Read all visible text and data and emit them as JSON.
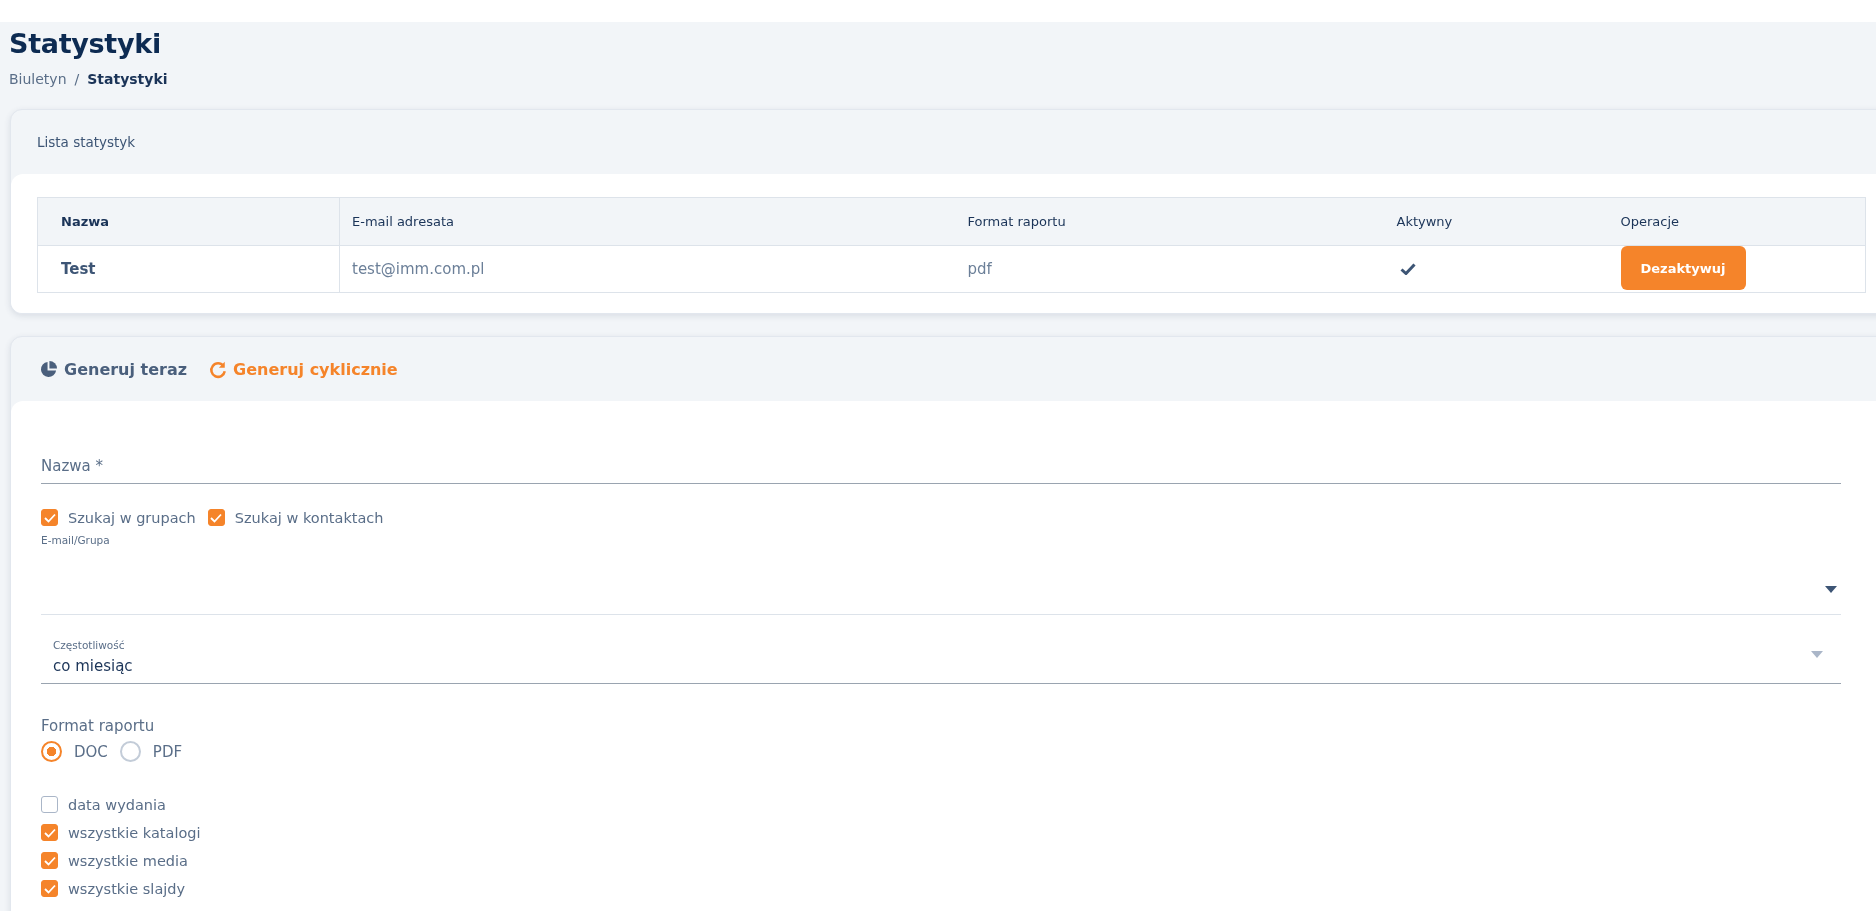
{
  "page": {
    "title": "Statystyki"
  },
  "breadcrumb_separator": "/",
  "breadcrumb": [
    {
      "label": "Biuletyn",
      "current": false
    },
    {
      "label": "Statystyki",
      "current": true
    }
  ],
  "list_card": {
    "title": "Lista statystyk",
    "table": {
      "columns": [
        "Nazwa",
        "E-mail adresata",
        "Format raportu",
        "Aktywny",
        "Operacje"
      ],
      "rows": [
        {
          "name": "Test",
          "email": "test@imm.com.pl",
          "format": "pdf",
          "active": true,
          "action": "Dezaktywuj"
        }
      ]
    }
  },
  "form_card": {
    "tabs": [
      {
        "label": "Generuj teraz",
        "kind": "chart",
        "selected": false
      },
      {
        "label": "Generuj cyklicznie",
        "kind": "refresh",
        "selected": true
      }
    ],
    "name_field": {
      "placeholder": "Nazwa *"
    },
    "search_options": [
      {
        "label": "Szukaj w grupach",
        "checked": true
      },
      {
        "label": "Szukaj w kontaktach",
        "checked": true
      }
    ],
    "recipient_select": {
      "label": "E-mail/Grupa"
    },
    "frequency_select": {
      "label": "Częstotliwość",
      "value": "co miesiąc",
      "disabled": true
    },
    "format": {
      "label": "Format raportu",
      "options": [
        {
          "label": "DOC",
          "selected": true
        },
        {
          "label": "PDF",
          "selected": false
        }
      ]
    },
    "include_options": [
      {
        "label": "data wydania",
        "checked": false
      },
      {
        "label": "wszystkie katalogi",
        "checked": true
      },
      {
        "label": "wszystkie media",
        "checked": true
      },
      {
        "label": "wszystkie slajdy",
        "checked": true
      }
    ]
  }
}
